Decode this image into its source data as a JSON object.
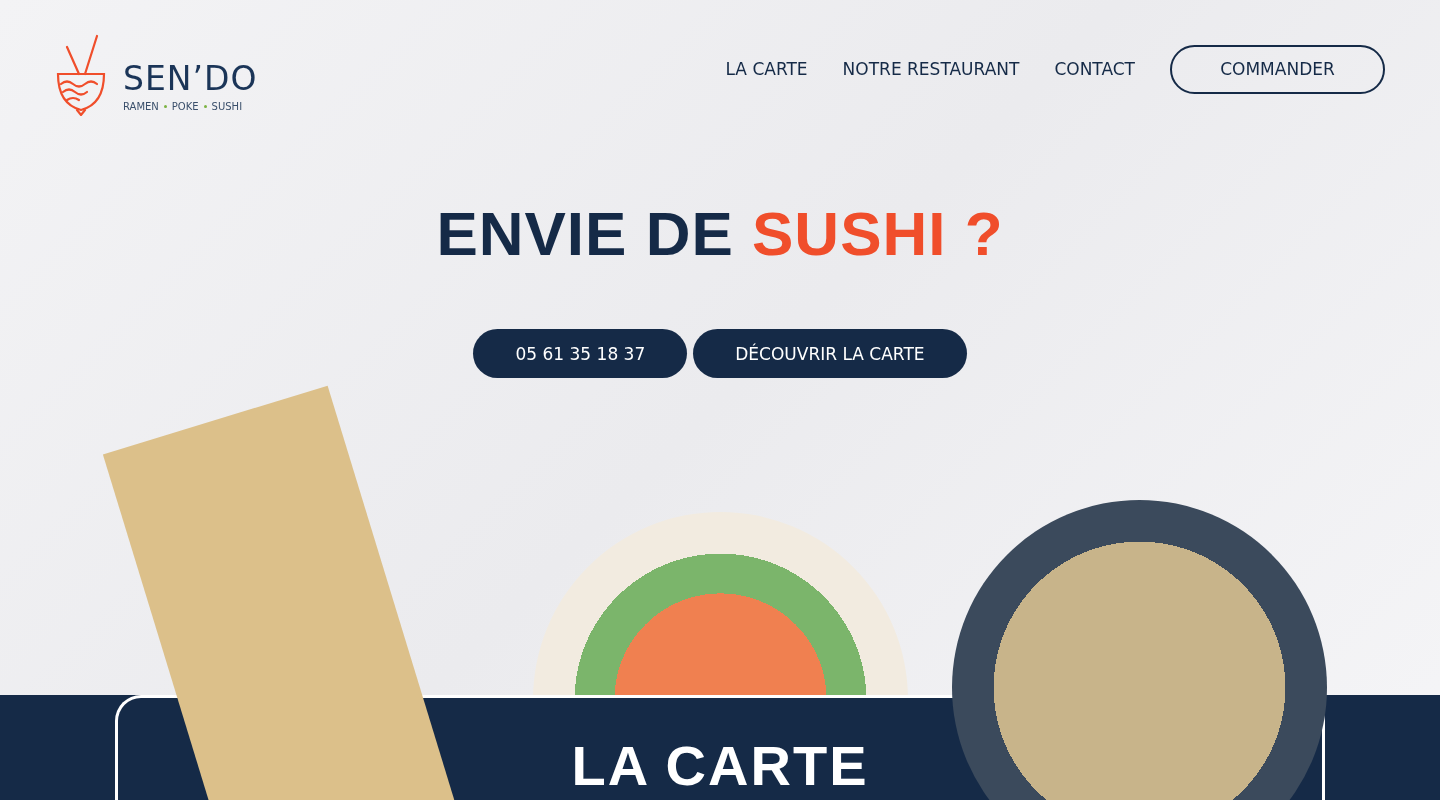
{
  "logo": {
    "name": "SEN’DO",
    "tagline": [
      "RAMEN",
      "POKE",
      "SUSHI"
    ]
  },
  "nav": {
    "links": [
      "LA CARTE",
      "NOTRE RESTAURANT",
      "CONTACT"
    ],
    "cta": "COMMANDER"
  },
  "hero": {
    "headline": "ENVIE DE",
    "highlight": "SUSHI ?",
    "buttons": [
      "05 61 35 18 37",
      "DÉCOUVRIR LA CARTE"
    ]
  },
  "section": {
    "title": "LA CARTE"
  }
}
